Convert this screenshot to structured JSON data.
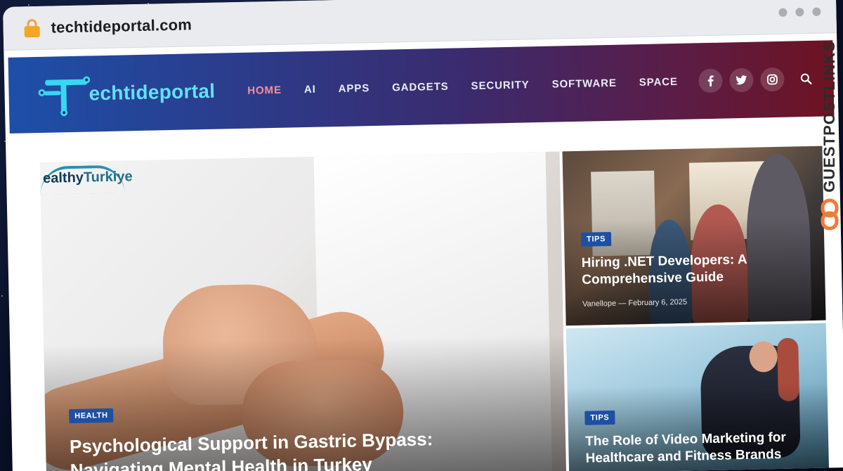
{
  "browser": {
    "url": "techtideportal.com"
  },
  "site": {
    "logo_text": "echtideportal",
    "nav": [
      {
        "label": "HOME",
        "active": true
      },
      {
        "label": "AI",
        "active": false
      },
      {
        "label": "APPS",
        "active": false
      },
      {
        "label": "GADGETS",
        "active": false
      },
      {
        "label": "SECURITY",
        "active": false
      },
      {
        "label": "SOFTWARE",
        "active": false
      },
      {
        "label": "SPACE",
        "active": false
      }
    ],
    "social": {
      "facebook": "f",
      "twitter": "t",
      "instagram": "i"
    }
  },
  "feature": {
    "brand_logo": "ealthy",
    "brand_logo_accent": "Turkiye",
    "badge": "HEALTH",
    "title": "Psychological Support in Gastric Bypass: Navigating Mental Health in Turkey"
  },
  "cards": [
    {
      "badge": "TIPS",
      "title": "Hiring .NET Developers: A Comprehensive Guide",
      "author": "Vanellope",
      "separator": "—",
      "date": "February 6, 2025"
    },
    {
      "badge": "TIPS",
      "title": "The Role of Video Marketing for Healthcare and Fitness Brands"
    }
  ],
  "watermark": {
    "text": "GUESTPOSTLINKS"
  },
  "colors": {
    "nav_active": "#ff8f8f",
    "badge_bg": "#1f4fa3",
    "logo_accent": "#3ad6f2"
  }
}
